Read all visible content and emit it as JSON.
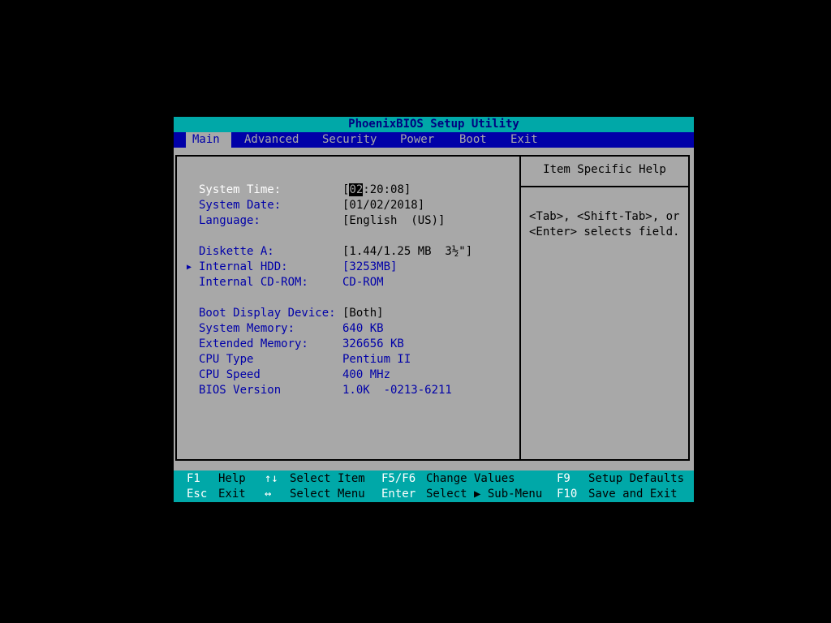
{
  "title": "PhoenixBIOS Setup Utility",
  "menu": [
    {
      "label": "Main",
      "active": true
    },
    {
      "label": "Advanced",
      "active": false
    },
    {
      "label": "Security",
      "active": false
    },
    {
      "label": "Power",
      "active": false
    },
    {
      "label": "Boot",
      "active": false
    },
    {
      "label": "Exit",
      "active": false
    }
  ],
  "main": {
    "system_time": {
      "label": "System Time:",
      "value_prefix": "[",
      "value_cursor": "02",
      "value_rest": ":20:08]"
    },
    "system_date": {
      "label": "System Date:",
      "value": "[01/02/2018]"
    },
    "language": {
      "label": "Language:",
      "value": "[English  (US)]"
    },
    "diskette_a": {
      "label": "Diskette A:",
      "value": "[1.44/1.25 MB  3½\"]"
    },
    "internal_hdd": {
      "label": "Internal HDD:",
      "value": "[3253MB]",
      "submenu_marker": "▶"
    },
    "internal_cdrom": {
      "label": "Internal CD-ROM:",
      "value": "CD-ROM"
    },
    "boot_display": {
      "label": "Boot Display Device:",
      "value": "[Both]"
    },
    "system_memory": {
      "label": "System Memory:",
      "value": "640 KB"
    },
    "extended_memory": {
      "label": "Extended Memory:",
      "value": "326656 KB"
    },
    "cpu_type": {
      "label": "CPU Type",
      "value": "Pentium II"
    },
    "cpu_speed": {
      "label": "CPU Speed",
      "value": "400 MHz"
    },
    "bios_version": {
      "label": "BIOS Version",
      "value": "1.0K  -0213-6211"
    }
  },
  "help": {
    "title": "Item Specific Help",
    "line1": "<Tab>, <Shift-Tab>, or",
    "line2": "<Enter> selects field."
  },
  "footer": {
    "f1_key": "F1",
    "f1_desc": "Help",
    "updown_key": "↑↓",
    "updown_desc": "Select Item",
    "f5f6_key": "F5/F6",
    "f5f6_desc": "Change Values",
    "f9_key": "F9",
    "f9_desc": "Setup Defaults",
    "esc_key": "Esc",
    "esc_desc": "Exit",
    "leftright_key": "↔",
    "leftright_desc": "Select Menu",
    "enter_key": "Enter",
    "enter_desc": "Select ▶ Sub-Menu",
    "f10_key": "F10",
    "f10_desc": "Save and Exit"
  },
  "colors": {
    "cyan": "#00a8a8",
    "blue": "#0000a8",
    "gray": "#a8a8a8",
    "white": "#ffffff",
    "black": "#000000"
  }
}
